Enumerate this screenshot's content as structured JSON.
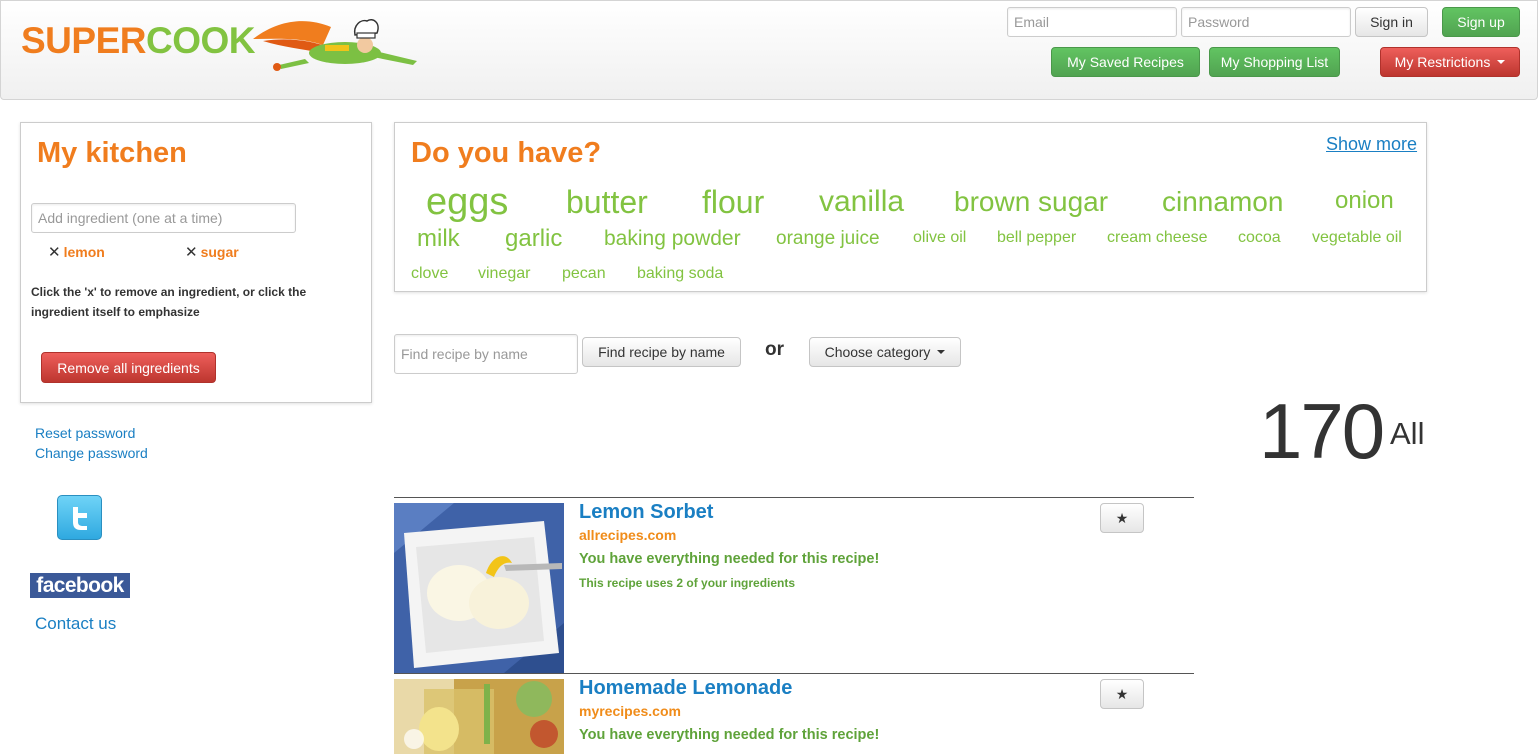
{
  "header": {
    "logo_super": "SUPER",
    "logo_cook": "COOK",
    "email_placeholder": "Email",
    "password_placeholder": "Password",
    "sign_in": "Sign in",
    "sign_up": "Sign up",
    "saved_recipes": "My Saved Recipes",
    "shopping_list": "My Shopping List",
    "restrictions": "My Restrictions"
  },
  "kitchen": {
    "title": "My kitchen",
    "add_placeholder": "Add ingredient (one at a time)",
    "ingredients": [
      "lemon",
      "sugar"
    ],
    "remove_symbol": "✕",
    "help_text": "Click the 'x' to remove an ingredient, or click the ingredient itself to emphasize",
    "remove_all": "Remove all ingredients"
  },
  "account_links": {
    "reset_password": "Reset password",
    "change_password": "Change password",
    "facebook": "facebook",
    "contact": "Contact us"
  },
  "suggestions": {
    "title": "Do you have?",
    "show_more": "Show more",
    "items": [
      "eggs",
      "butter",
      "flour",
      "vanilla",
      "brown sugar",
      "cinnamon",
      "onion",
      "milk",
      "garlic",
      "baking powder",
      "orange juice",
      "olive oil",
      "bell pepper",
      "cream cheese",
      "cocoa",
      "vegetable oil",
      "clove",
      "vinegar",
      "pecan",
      "baking soda"
    ]
  },
  "search": {
    "name_placeholder": "Find recipe by name",
    "name_button": "Find recipe by name",
    "or": "or",
    "category_button": "Choose category"
  },
  "count": {
    "value": "170",
    "label": "All"
  },
  "recipes": [
    {
      "title": "Lemon Sorbet",
      "source": "allrecipes.com",
      "have": "You have everything needed for this recipe!",
      "uses": "This recipe uses 2 of your ingredients",
      "star": "★"
    },
    {
      "title": "Homemade Lemonade",
      "source": "myrecipes.com",
      "have": "You have everything needed for this recipe!",
      "star": "★"
    }
  ],
  "colors": {
    "brand_orange": "#f07d1e",
    "brand_green": "#82c341",
    "link_blue": "#1a7fc3",
    "button_green": "#5bb75b",
    "button_red": "#da4f49"
  }
}
